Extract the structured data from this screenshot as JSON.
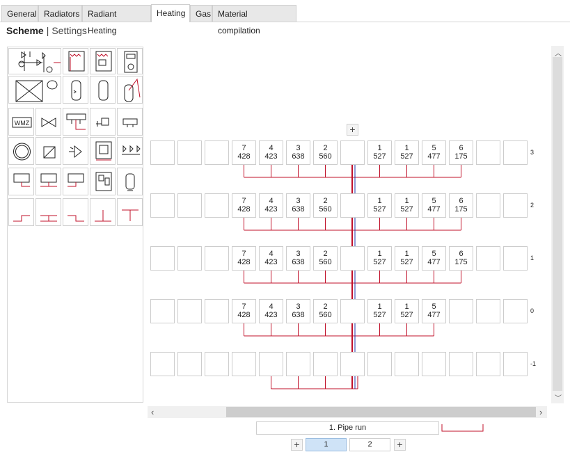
{
  "tabs": [
    {
      "label": "General",
      "active": false
    },
    {
      "label": "Radiators",
      "active": false
    },
    {
      "label": "Radiant Heating",
      "active": false
    },
    {
      "label": "Heating",
      "active": true
    },
    {
      "label": "Gas",
      "active": false
    },
    {
      "label": "Material compilation",
      "active": false
    }
  ],
  "subnav": {
    "scheme": "Scheme",
    "separator": "|",
    "settings": "Settings"
  },
  "palette": {
    "icons": [
      "pump-group-icon",
      "boiler-wall-icon",
      "boiler-panel-icon",
      "boiler-clock-icon",
      "buffer-tank-icon",
      "storage-tank-icon",
      "storage-tank-2-icon",
      "solar-tank-icon",
      "heat-meter-icon",
      "valve-icon",
      "manifold-icon",
      "valve-actuator-icon",
      "connector-icon",
      "circle-icon",
      "mixer-icon",
      "pump-icon",
      "control-unit-icon",
      "manifold-valves-icon",
      "radiator-icon",
      "radiator-center-icon",
      "radiator-right-icon",
      "boiler-unit-icon",
      "water-heater-icon",
      "pipe-left-icon",
      "pipe-center-icon",
      "pipe-right-icon",
      "pipe-t-icon",
      "pipe-t-down-icon"
    ],
    "heat_meter_label": "WMZ"
  },
  "diagram": {
    "add_label": "+",
    "floors": [
      {
        "label": "3",
        "units": [
          {
            "n": "7",
            "v": "428"
          },
          {
            "n": "4",
            "v": "423"
          },
          {
            "n": "3",
            "v": "638"
          },
          {
            "n": "2",
            "v": "560"
          },
          {
            "n": "1",
            "v": "527"
          },
          {
            "n": "1",
            "v": "527"
          },
          {
            "n": "5",
            "v": "477"
          },
          {
            "n": "6",
            "v": "175"
          }
        ]
      },
      {
        "label": "2",
        "units": [
          {
            "n": "7",
            "v": "428"
          },
          {
            "n": "4",
            "v": "423"
          },
          {
            "n": "3",
            "v": "638"
          },
          {
            "n": "2",
            "v": "560"
          },
          {
            "n": "1",
            "v": "527"
          },
          {
            "n": "1",
            "v": "527"
          },
          {
            "n": "5",
            "v": "477"
          },
          {
            "n": "6",
            "v": "175"
          }
        ]
      },
      {
        "label": "1",
        "units": [
          {
            "n": "7",
            "v": "428"
          },
          {
            "n": "4",
            "v": "423"
          },
          {
            "n": "3",
            "v": "638"
          },
          {
            "n": "2",
            "v": "560"
          },
          {
            "n": "1",
            "v": "527"
          },
          {
            "n": "1",
            "v": "527"
          },
          {
            "n": "5",
            "v": "477"
          },
          {
            "n": "6",
            "v": "175"
          }
        ]
      },
      {
        "label": "0",
        "units": [
          {
            "n": "7",
            "v": "428"
          },
          {
            "n": "4",
            "v": "423"
          },
          {
            "n": "3",
            "v": "638"
          },
          {
            "n": "2",
            "v": "560"
          },
          {
            "n": "1",
            "v": "527"
          },
          {
            "n": "1",
            "v": "527"
          },
          {
            "n": "5",
            "v": "477"
          }
        ]
      },
      {
        "label": "-1",
        "units": []
      }
    ]
  },
  "footer": {
    "pipe_run": "1. Pipe run",
    "pages": [
      "1",
      "2"
    ],
    "add_label": "+"
  },
  "colors": {
    "pipe_red": "#c0102a",
    "pipe_blue": "#2233aa",
    "active_page": "#cfe3f7"
  }
}
